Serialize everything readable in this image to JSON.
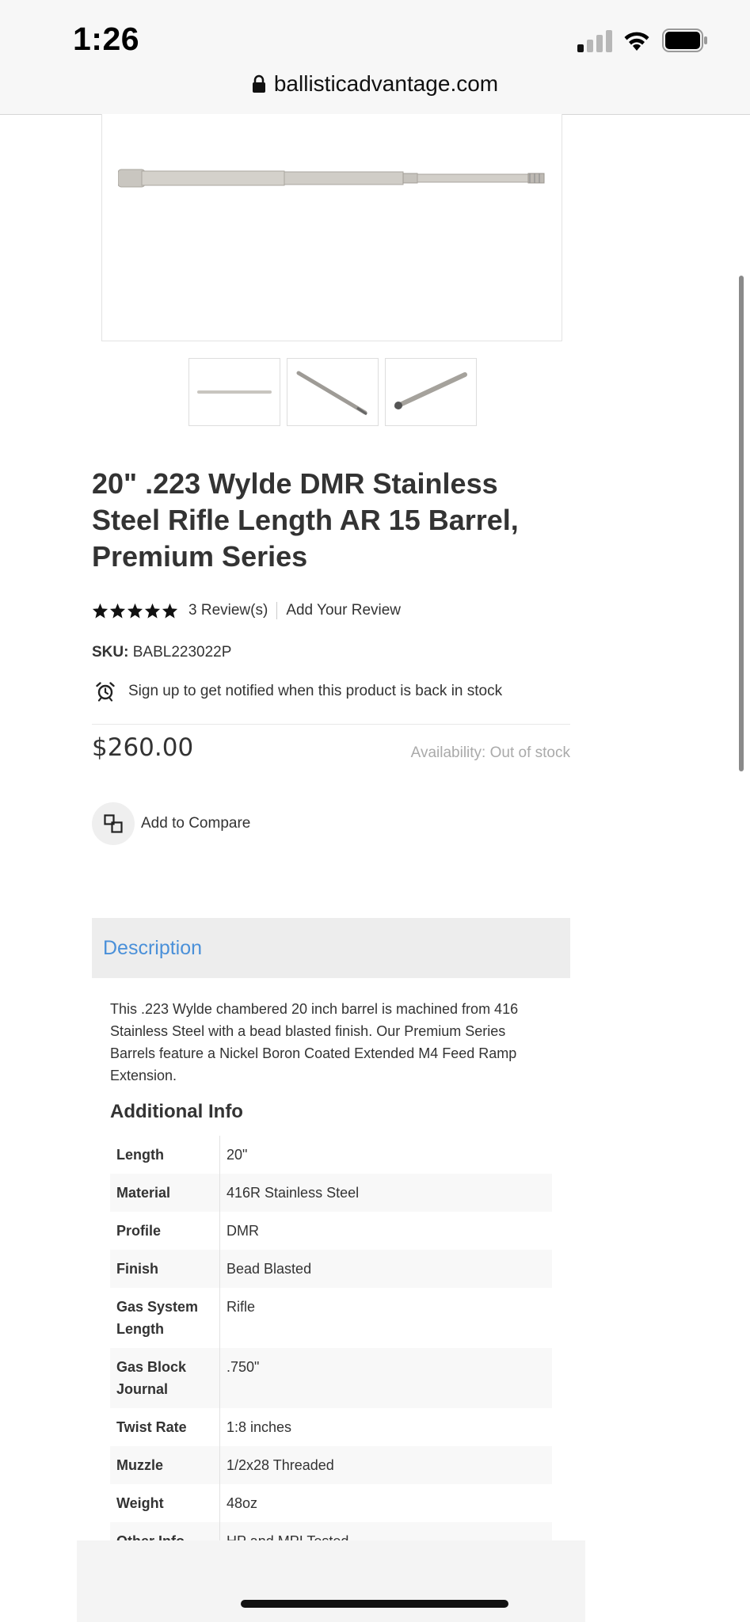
{
  "status_bar": {
    "time": "1:26"
  },
  "browser": {
    "url": "ballisticadvantage.com"
  },
  "product": {
    "title": "20\" .223 Wylde DMR Stainless Steel Rifle Length AR 15 Barrel, Premium Series",
    "rating_stars": 5,
    "rating_max": 5,
    "reviews_label": "3 Review(s)",
    "add_review_label": "Add Your Review",
    "sku_label": "SKU:",
    "sku_value": "BABL223022P",
    "notify_text": "Sign up to get notified when this product is back in stock",
    "price": "$260.00",
    "availability": "Availability: Out of stock",
    "compare_label": "Add to Compare"
  },
  "icons": {
    "lock": "lock-icon",
    "alarm": "alarm-clock-icon",
    "compare": "compare-icon",
    "star": "star-icon"
  },
  "description": {
    "header": "Description",
    "text": "This .223 Wylde chambered 20 inch barrel is machined from 416 Stainless Steel with a bead blasted finish. Our Premium Series Barrels feature a Nickel Boron Coated Extended M4 Feed Ramp Extension.",
    "additional_info_title": "Additional Info",
    "specs": [
      {
        "label": "Length",
        "value": "20\""
      },
      {
        "label": "Material",
        "value": "416R Stainless Steel"
      },
      {
        "label": "Profile",
        "value": "DMR"
      },
      {
        "label": "Finish",
        "value": "Bead Blasted"
      },
      {
        "label": "Gas System Length",
        "value": "Rifle"
      },
      {
        "label": "Gas Block Journal",
        "value": ".750\""
      },
      {
        "label": "Twist Rate",
        "value": "1:8 inches"
      },
      {
        "label": "Muzzle",
        "value": "1/2x28 Threaded"
      },
      {
        "label": "Weight",
        "value": "48oz"
      },
      {
        "label": "Other Info",
        "value": "HP and MPI Tested"
      }
    ]
  },
  "colors": {
    "accent_link": "#4a90d9",
    "text": "#333333",
    "muted": "#aaaaaa",
    "header_bg": "#ededed"
  }
}
